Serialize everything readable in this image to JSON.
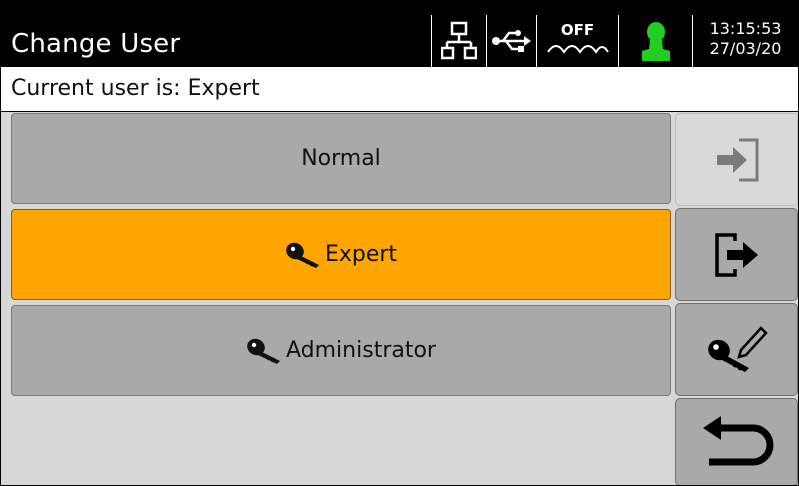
{
  "header": {
    "title": "Change User",
    "status": {
      "network_icon": "network-icon",
      "usb_icon": "usb-icon",
      "heater_label": "OFF",
      "heater_icon": "water-wave-icon",
      "user_icon": "user-icon",
      "user_icon_color": "#22cc22"
    },
    "time": "13:15:53",
    "date": "27/03/20"
  },
  "info": {
    "current_user_text": "Current user is: Expert"
  },
  "users": [
    {
      "label": "Normal",
      "has_key": false,
      "selected": false
    },
    {
      "label": "Expert",
      "has_key": true,
      "selected": true
    },
    {
      "label": "Administrator",
      "has_key": true,
      "selected": false
    }
  ],
  "side_buttons": {
    "login": {
      "icon": "login-icon",
      "enabled": false
    },
    "logout": {
      "icon": "logout-icon",
      "enabled": true
    },
    "edit_password": {
      "icon": "key-edit-icon",
      "enabled": true
    },
    "back": {
      "icon": "back-arrow-icon",
      "enabled": true
    }
  },
  "colors": {
    "selected": "#ffa500",
    "button": "#a9a9a9",
    "header_bg": "#000000"
  }
}
